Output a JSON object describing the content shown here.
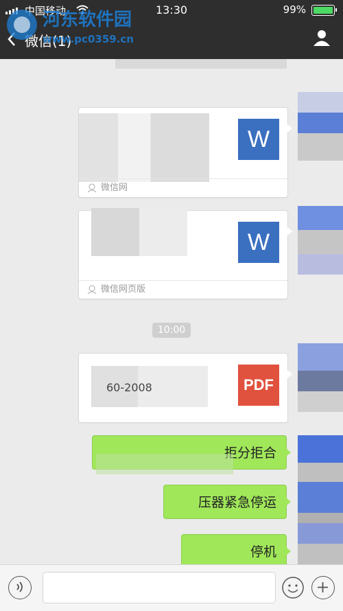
{
  "status_bar": {
    "carrier": "中国移动",
    "time": "13:30",
    "battery": "99%"
  },
  "nav": {
    "title": "微信(1)"
  },
  "watermark": {
    "text": "河东软件园",
    "url": "www.pc0359.cn"
  },
  "chat": {
    "time_separator": "10:00",
    "messages": [
      {
        "type": "file",
        "icon_label": "W",
        "footer": "微信网"
      },
      {
        "type": "file",
        "icon_label": "W",
        "footer": "微信网页版"
      },
      {
        "type": "file",
        "icon_label": "PDF",
        "name_partial": "60-2008",
        "footer": ""
      },
      {
        "type": "text",
        "text": "拒分拒合"
      },
      {
        "type": "text",
        "text": "压器紧急停运"
      },
      {
        "type": "text",
        "text": "停机"
      }
    ]
  },
  "colors": {
    "bubble_green": "#a0e75a",
    "word_blue": "#3b6fc0",
    "pdf_red": "#e0523e",
    "header_dark": "#2e2e2e"
  }
}
